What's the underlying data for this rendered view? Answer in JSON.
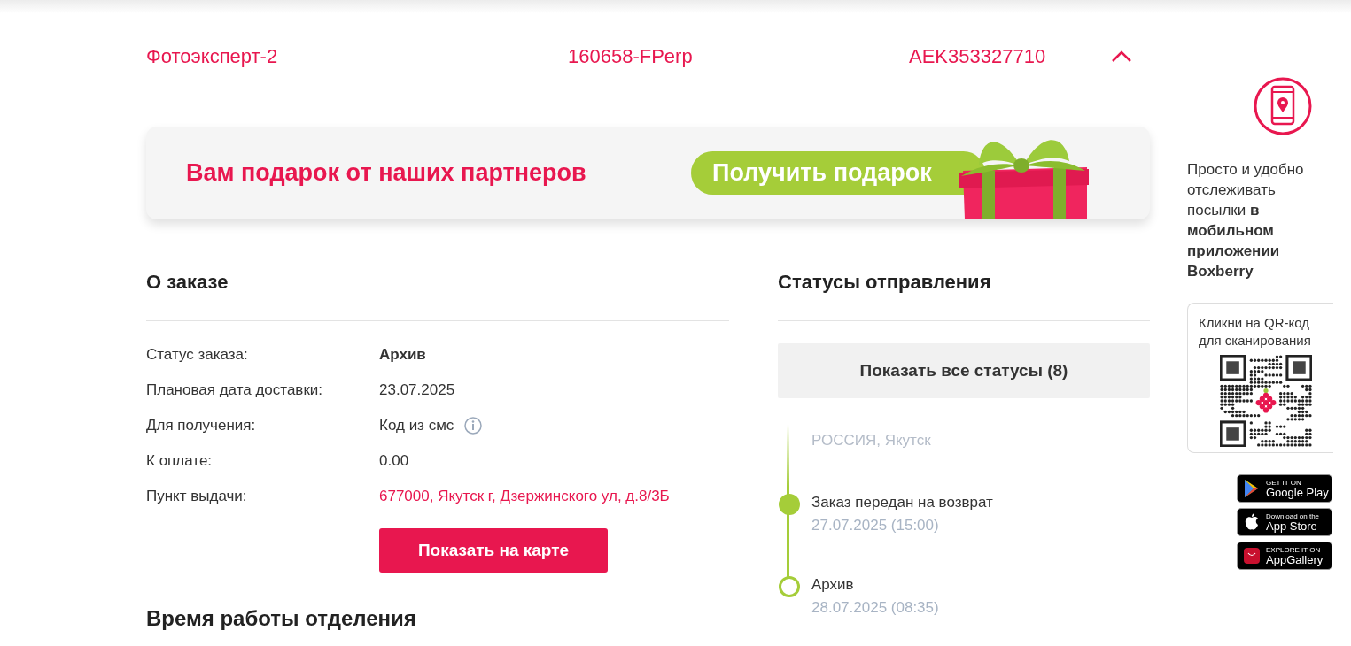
{
  "order_header": {
    "shop": "Фотоэксперт-2",
    "order_number": "160658-FPerp",
    "tracking": "AEK353327710",
    "expanded": true
  },
  "promo": {
    "title": "Вам подарок от наших партнеров",
    "button": "Получить подарок"
  },
  "about": {
    "title": "О заказе",
    "fields": [
      {
        "label": "Статус заказа:",
        "value": "Архив",
        "kind": "bold"
      },
      {
        "label": "Плановая дата доставки:",
        "value": "23.07.2025",
        "kind": "plain"
      },
      {
        "label": "Для получения:",
        "value": "Код из смс",
        "kind": "info"
      },
      {
        "label": "К оплате:",
        "value": "0.00",
        "kind": "plain"
      },
      {
        "label": "Пункт выдачи:",
        "value": "677000, Якутск г, Дзержинского ул, д.8/3Б",
        "kind": "link"
      }
    ],
    "map_button": "Показать на карте",
    "hours_title": "Время работы отделения"
  },
  "statuses": {
    "title": "Статусы отправления",
    "show_all_button": "Показать все статусы (8)",
    "items": [
      {
        "kind": "faded",
        "title": "РОССИЯ, Якутск"
      },
      {
        "kind": "filled",
        "title": "Заказ передан на возврат",
        "date": "27.07.2025 (15:00)"
      },
      {
        "kind": "hollow",
        "title": "Архив",
        "date": "28.07.2025 (08:35)"
      }
    ]
  },
  "app_promo": {
    "text": "Просто и удобно отслеживать посылки **в мобильном приложении Boxberry**",
    "qr_hint": "Кликни на QR-код для сканирования",
    "stores": [
      {
        "kind": "google",
        "small": "GET IT ON",
        "big": "Google Play"
      },
      {
        "kind": "apple",
        "small": "Download on the",
        "big": "App Store"
      },
      {
        "kind": "huawei",
        "small": "EXPLORE IT ON",
        "big": "AppGallery"
      }
    ]
  }
}
